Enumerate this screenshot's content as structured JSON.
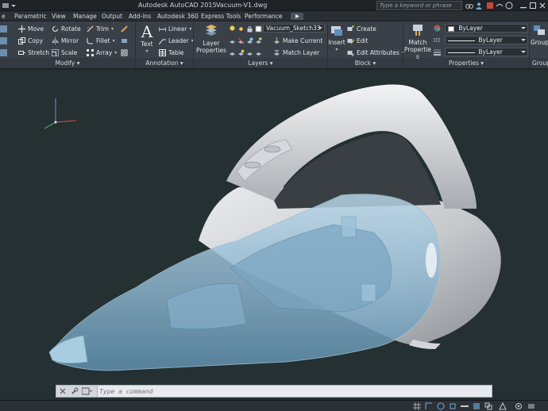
{
  "app": {
    "title": "Autodesk AutoCAD 2015",
    "file": "Vacuum-V1.dwg",
    "search_placeholder": "Type a keyword or phrase"
  },
  "tabs": [
    "Parametric",
    "View",
    "Manage",
    "Output",
    "Add-ins",
    "Autodesk 360",
    "Express Tools",
    "Performance"
  ],
  "modify": {
    "title": "Modify",
    "items": [
      "Move",
      "Rotate",
      "Trim",
      "Copy",
      "Mirror",
      "Fillet",
      "Stretch",
      "Scale",
      "Array"
    ]
  },
  "annotation": {
    "title": "Annotation",
    "text_label": "Text",
    "items": [
      "Linear",
      "Leader",
      "Table"
    ]
  },
  "layers": {
    "title": "Layers",
    "layer_properties_label": "Layer Properties",
    "current_layer": "Vacuum_Sketch33",
    "items": [
      "Make Current",
      "Match Layer"
    ]
  },
  "block": {
    "title": "Block",
    "insert_label": "Insert",
    "items": [
      "Create",
      "Edit",
      "Edit Attributes"
    ]
  },
  "properties": {
    "title": "Properties",
    "match_label": "Match Properties",
    "color": "ByLayer",
    "linetype": "ByLayer",
    "lineweight": "ByLayer"
  },
  "groups": {
    "title": "Group",
    "label": "Group"
  },
  "command": {
    "placeholder": "Type a command"
  },
  "colors": {
    "ribbon": "#3a4047",
    "viewport": "#243031",
    "body_grey": "#c9ccd0",
    "canister_blue": "#8fb6cf"
  }
}
